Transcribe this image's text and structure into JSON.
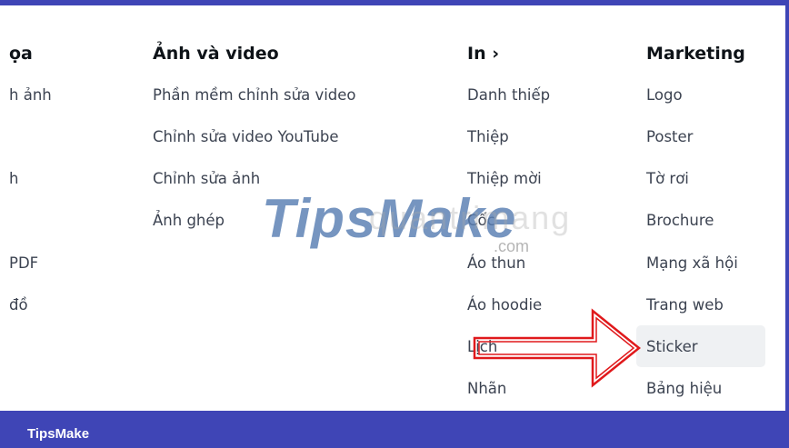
{
  "columns": [
    {
      "heading": "ọa",
      "items": [
        "h ảnh",
        "",
        "h",
        "",
        "PDF",
        "đồ"
      ]
    },
    {
      "heading": "Ảnh và video",
      "items": [
        "Phần mềm chỉnh sửa video",
        "Chỉnh sửa video YouTube",
        "Chỉnh sửa ảnh",
        "Ảnh ghép"
      ]
    },
    {
      "heading": "In ›",
      "items": [
        "Danh thiếp",
        "Thiệp",
        "Thiệp mời",
        "Cốc",
        "Áo thun",
        "Áo hoodie",
        "Lịch",
        "Nhãn"
      ]
    },
    {
      "heading": "Marketing",
      "items": [
        "Logo",
        "Poster",
        "Tờ rơi",
        "Brochure",
        "Mạng xã hội",
        "Trang web",
        "Sticker",
        "Bảng hiệu"
      ]
    }
  ],
  "watermark": {
    "brand": "TipsMake",
    "suffix": ".com",
    "faint": "quantrimang"
  },
  "footer": {
    "brand": "TipsMake"
  },
  "colors": {
    "frame": "#3f45b6",
    "arrow": "#e0191c",
    "highlight": "#eff1f3"
  }
}
